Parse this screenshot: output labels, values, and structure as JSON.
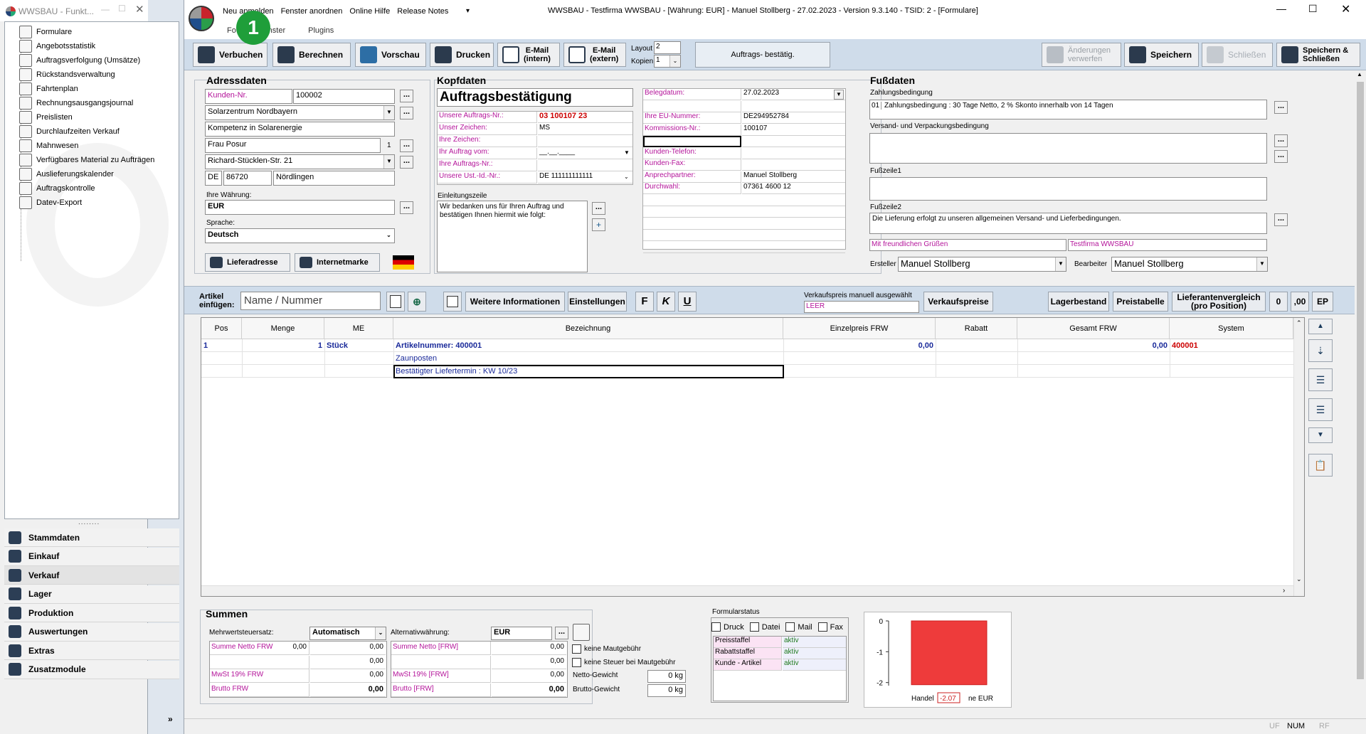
{
  "left_window": {
    "title": "WWSBAU - Funkt...",
    "tree": [
      {
        "label": "Formulare",
        "icon": "document-icon"
      },
      {
        "label": "Angebotsstatistik",
        "icon": "calculator-icon"
      },
      {
        "label": "Auftragsverfolgung (Umsätze)",
        "icon": "tracking-icon"
      },
      {
        "label": "Rückstandsverwaltung",
        "icon": "backlog-icon"
      },
      {
        "label": "Fahrtenplan",
        "icon": "truck-icon"
      },
      {
        "label": "Rechnungsausgangsjournal",
        "icon": "journal-icon"
      },
      {
        "label": "Preislisten",
        "icon": "price-tag-icon"
      },
      {
        "label": "Durchlaufzeiten Verkauf",
        "icon": "hourglass-icon"
      },
      {
        "label": "Mahnwesen",
        "icon": "dunning-icon"
      },
      {
        "label": "Verfügbares Material zu Aufträgen",
        "icon": "material-icon"
      },
      {
        "label": "Auslieferungskalender",
        "icon": "calendar-icon"
      },
      {
        "label": "Auftragskontrolle",
        "icon": "control-icon"
      },
      {
        "label": "Datev-Export",
        "icon": "datev-icon"
      }
    ],
    "nav": [
      {
        "label": "Stammdaten",
        "icon": "master-data-icon"
      },
      {
        "label": "Einkauf",
        "icon": "purchase-icon"
      },
      {
        "label": "Verkauf",
        "icon": "sales-icon"
      },
      {
        "label": "Lager",
        "icon": "warehouse-icon"
      },
      {
        "label": "Produktion",
        "icon": "production-icon"
      },
      {
        "label": "Auswertungen",
        "icon": "reports-icon"
      },
      {
        "label": "Extras",
        "icon": "extras-icon"
      },
      {
        "label": "Zusatzmodule",
        "icon": "addons-icon"
      }
    ]
  },
  "main_window": {
    "title": "WWSBAU - Testfirma WWSBAU - [Währung: EUR] - Manuel Stollberg - 27.02.2023 - Version 9.3.140 - TSID: 2 - [Formulare]",
    "menu_top": [
      "Neu anmelden",
      "Fenster anordnen",
      "Online Hilfe",
      "Release Notes"
    ],
    "menu_bottom": [
      "Fo",
      "Fenster",
      "Plugins"
    ],
    "badge": "1"
  },
  "toolbar": {
    "verbuchen": "Verbuchen",
    "berechnen": "Berechnen",
    "vorschau": "Vorschau",
    "drucken": "Drucken",
    "email_intern_1": "E-Mail",
    "email_intern_2": "(intern)",
    "email_extern_1": "E-Mail",
    "email_extern_2": "(extern)",
    "layout_label": "Layout",
    "layout_value": "2",
    "kopien_label": "Kopien",
    "kopien_value": "1",
    "status": "Auftrags- bestätig.",
    "aenderungen_1": "Änderungen",
    "aenderungen_2": "verwerfen",
    "speichern": "Speichern",
    "schliessen": "Schließen",
    "speichern_schliessen_1": "Speichern &",
    "speichern_schliessen_2": "Schließen"
  },
  "adressdaten": {
    "title": "Adressdaten",
    "kunden_nr_label": "Kunden-Nr.",
    "kunden_nr": "100002",
    "name1": "Solarzentrum Nordbayern",
    "name2": "Kompetenz in Solarenergie",
    "contact": "Frau Posur",
    "contact_no": "1",
    "street": "Richard-Stücklen-Str. 21",
    "country": "DE",
    "zip": "86720",
    "city": "Nördlingen",
    "waehrung_label": "Ihre Währung:",
    "waehrung": "EUR",
    "sprache_label": "Sprache:",
    "sprache": "Deutsch",
    "lieferadresse": "Lieferadresse",
    "internetmarke": "Internetmarke"
  },
  "kopfdaten": {
    "title": "Kopfdaten",
    "doc_title": "Auftragsbestätigung",
    "rows_left": [
      {
        "label": "Unsere Auftrags-Nr.:",
        "value": "03 100107 23"
      },
      {
        "label": "Unser Zeichen:",
        "value": "MS"
      },
      {
        "label": "Ihre Zeichen:",
        "value": ""
      },
      {
        "label": "Ihr Auftrag vom:",
        "value": "__.__.____"
      },
      {
        "label": "Ihre Auftrags-Nr.:",
        "value": ""
      },
      {
        "label": "Unsere Ust.-Id.-Nr.:",
        "value": "DE 111111111111"
      }
    ],
    "rows_right": [
      {
        "label": "Belegdatum:",
        "value": "27.02.2023"
      },
      {
        "label": "",
        "value": ""
      },
      {
        "label": "Ihre EU-Nummer:",
        "value": "DE294952784"
      },
      {
        "label": "Kommissions-Nr.:",
        "value": "100107"
      },
      {
        "label": "",
        "value": ""
      },
      {
        "label": "Kunden-Telefon:",
        "value": ""
      },
      {
        "label": "Kunden-Fax:",
        "value": ""
      },
      {
        "label": "Anprechpartner:",
        "value": "Manuel Stollberg"
      },
      {
        "label": "Durchwahl:",
        "value": "07361 4600 12"
      }
    ],
    "einleitung_label": "Einleitungszeile",
    "einleitung": "Wir bedanken uns für Ihren Auftrag und bestätigen Ihnen hiermit wie folgt:"
  },
  "fussdaten": {
    "title": "Fußdaten",
    "zahlung_label": "Zahlungsbedingung",
    "zahlung_code": "01",
    "zahlung": "Zahlungsbedingung : 30 Tage Netto, 2 % Skonto innerhalb von 14 Tagen",
    "versand_label": "Versand- und Verpackungsbedingung",
    "fusszeile1_label": "Fußzeile1",
    "fusszeile2_label": "Fußzeile2",
    "fusszeile2": "Die Lieferung erfolgt zu unseren allgemeinen Versand- und Lieferbedingungen.",
    "gruss": "Mit freundlichen Grüßen",
    "firma": "Testfirma WWSBAU",
    "ersteller_label": "Ersteller",
    "ersteller": "Manuel Stollberg",
    "bearbeiter_label": "Bearbeiter",
    "bearbeiter": "Manuel Stollberg"
  },
  "artikelbar": {
    "label_1": "Artikel",
    "label_2": "einfügen:",
    "placeholder": "Name / Nummer",
    "weitere": "Weitere Informationen",
    "einstellungen": "Einstellungen",
    "fmt_bold": "F",
    "fmt_italic": "K",
    "fmt_underline": "U",
    "vk_label": "Verkaufspreis manuell ausgewählt",
    "vk_value": "LEER",
    "verkaufspreise": "Verkaufspreise",
    "lagerbestand": "Lagerbestand",
    "preistabelle": "Preistabelle",
    "lieferantenvergleich_1": "Lieferantenvergleich",
    "lieferantenvergleich_2": "(pro Position)",
    "btn_0": "0",
    "btn_00": ",00",
    "btn_ep": "EP"
  },
  "grid": {
    "columns": [
      "Pos",
      "Menge",
      "ME",
      "Bezeichnung",
      "Einzelpreis FRW",
      "Rabatt",
      "Gesamt FRW",
      "System"
    ],
    "rows": [
      {
        "pos": "1",
        "menge": "1",
        "me": "Stück",
        "bez": "Artikelnummer: 400001",
        "ep": "0,00",
        "rabatt": "",
        "gesamt": "0,00",
        "system": "400001"
      },
      {
        "pos": "",
        "menge": "",
        "me": "",
        "bez": "Zaunposten",
        "ep": "",
        "rabatt": "",
        "gesamt": "",
        "system": ""
      },
      {
        "pos": "",
        "menge": "",
        "me": "",
        "bez": "Bestätigter Liefertermin : KW 10/23",
        "ep": "",
        "rabatt": "",
        "gesamt": "",
        "system": ""
      }
    ]
  },
  "summen": {
    "title": "Summen",
    "mwst_label": "Mehrwertsteuersatz:",
    "mwst_mode": "Automatisch",
    "alt_label": "Alternativwährung:",
    "alt_value": "EUR",
    "left": [
      {
        "label": "Summe Netto FRW",
        "v1": "0,00",
        "v2": "0,00"
      },
      {
        "label": "",
        "v1": "",
        "v2": "0,00"
      },
      {
        "label": "MwSt 19% FRW",
        "v1": "",
        "v2": "0,00"
      },
      {
        "label": "Brutto FRW",
        "v1": "",
        "v2": "0,00"
      }
    ],
    "right": [
      {
        "label": "Summe Netto [FRW]",
        "v": "0,00"
      },
      {
        "label": "",
        "v": "0,00"
      },
      {
        "label": "MwSt 19% [FRW]",
        "v": "0,00"
      },
      {
        "label": "Brutto [FRW]",
        "v": "0,00"
      }
    ],
    "keine_maut": "keine Mautgebühr",
    "keine_steuer": "keine Steuer bei Mautgebühr",
    "netto_gewicht_label": "Netto-Gewicht",
    "netto_gewicht": "0 kg",
    "brutto_gewicht_label": "Brutto-Gewicht",
    "brutto_gewicht": "0 kg"
  },
  "formularstatus": {
    "title": "Formularstatus",
    "checks": [
      "Druck",
      "Datei",
      "Mail",
      "Fax"
    ],
    "rows": [
      {
        "label": "Preisstaffel",
        "value": "aktiv"
      },
      {
        "label": "Rabattstaffel",
        "value": "aktiv"
      },
      {
        "label": "Kunde - Artikel",
        "value": "aktiv"
      }
    ]
  },
  "chart_data": {
    "type": "bar",
    "categories": [
      "Handel"
    ],
    "values": [
      -2.07
    ],
    "ylim": [
      -2.1,
      0
    ],
    "yticks": [
      "0",
      "-1",
      "-2"
    ],
    "xlabel_left": "Handel",
    "xlabel_right": "ne EUR",
    "data_label": "-2.07",
    "bar_color": "#ee3b3b"
  },
  "statusbar": {
    "uf": "UF",
    "num": "NUM",
    "rf": "RF"
  }
}
